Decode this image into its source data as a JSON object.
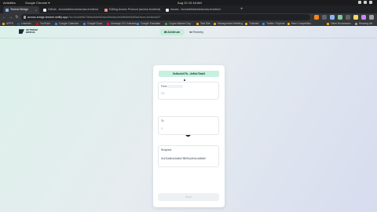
{
  "os": {
    "activities": "Activities",
    "app": "Google Chrome ▾",
    "clock": "Aug 22  10:18 AM"
  },
  "browser": {
    "tabs": [
      {
        "label": "Testnet Bridge"
      },
      {
        "label": "Github - AcrossNetwork/across-frontend"
      },
      {
        "label": "Editing Across Protocol (across-frontend)"
      },
      {
        "label": "Issues · AcrossNetwork/across-frontend"
      }
    ],
    "url_host": "across-bridge-testnet.netlify.app",
    "url_path": "/?to=0x44b9b73b9a4c5e5f2a4c83ed4a1e0e5b5e5d2f0a&from=0x4bc4c07"
  },
  "bookmarks": [
    {
      "label": "APPS"
    },
    {
      "label": "LinkedIn"
    },
    {
      "label": "YouTube"
    },
    {
      "label": "Google Calendar"
    },
    {
      "label": "Google Docs"
    },
    {
      "label": "Uniswap V2 Contracts"
    },
    {
      "label": "Google Translate"
    },
    {
      "label": "Crypto Market Cap"
    },
    {
      "label": "Test Site"
    },
    {
      "label": "Management Meeting"
    },
    {
      "label": "Tutorials"
    },
    {
      "label": "Twitter / Explore"
    },
    {
      "label": "New Competition"
    },
    {
      "label": "Other Bookmarks"
    },
    {
      "label": "Reading list"
    }
  ],
  "page": {
    "logo_line1": "OPTIMISM",
    "logo_line2": "BRIDGE",
    "modes": [
      {
        "label": "Arbitrum"
      },
      {
        "label": "Rinkeby"
      }
    ],
    "network_banner": "0x4bc4c07b...4e8dc73ad3",
    "send": {
      "label": "From",
      "value": "0.0"
    },
    "receive_to": {
      "label": "To",
      "value": "0"
    },
    "recipient": {
      "label": "Recipient",
      "value": "0x1f2a3b4c5d6e7f8091a2b3c4d5e6f"
    },
    "action_button": "Send"
  },
  "colors": {
    "accent": "#c7f0df",
    "page_bg_start": "#dcf1ea",
    "page_bg_end": "#d7dcef"
  }
}
